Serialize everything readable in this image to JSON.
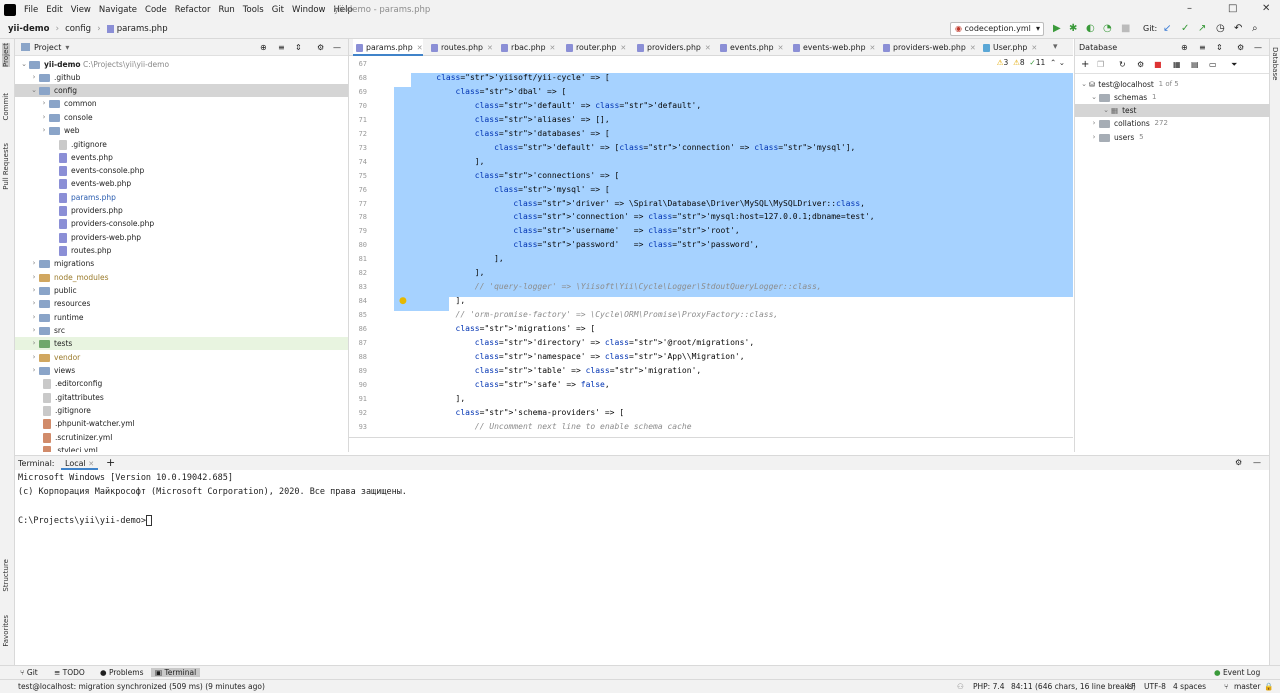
{
  "menu": [
    "File",
    "Edit",
    "View",
    "Navigate",
    "Code",
    "Refactor",
    "Run",
    "Tools",
    "Git",
    "Window",
    "Help"
  ],
  "window_title": "yii-demo - params.php",
  "breadcrumb": [
    "yii-demo",
    "config",
    "params.php"
  ],
  "run_config": "codeception.yml",
  "git_label": "Git:",
  "left_stripe": [
    "Project",
    "Commit",
    "Pull Requests",
    "Structure",
    "Favorites"
  ],
  "right_stripe": [
    "Database"
  ],
  "project": {
    "header": "Project",
    "root": "yii-demo",
    "root_path": "C:\\Projects\\yii\\yii-demo",
    "items": [
      {
        "label": ".github",
        "type": "folder"
      },
      {
        "label": "config",
        "type": "folder"
      },
      {
        "label": "common",
        "type": "folder"
      },
      {
        "label": "console",
        "type": "folder"
      },
      {
        "label": "web",
        "type": "folder"
      },
      {
        "label": ".gitignore",
        "type": "file"
      },
      {
        "label": "events.php",
        "type": "php"
      },
      {
        "label": "events-console.php",
        "type": "php"
      },
      {
        "label": "events-web.php",
        "type": "php"
      },
      {
        "label": "params.php",
        "type": "php"
      },
      {
        "label": "providers.php",
        "type": "php"
      },
      {
        "label": "providers-console.php",
        "type": "php"
      },
      {
        "label": "providers-web.php",
        "type": "php"
      },
      {
        "label": "routes.php",
        "type": "php"
      },
      {
        "label": "migrations",
        "type": "folder"
      },
      {
        "label": "node_modules",
        "type": "folder"
      },
      {
        "label": "public",
        "type": "folder"
      },
      {
        "label": "resources",
        "type": "folder"
      },
      {
        "label": "runtime",
        "type": "folder"
      },
      {
        "label": "src",
        "type": "folder"
      },
      {
        "label": "tests",
        "type": "folder"
      },
      {
        "label": "vendor",
        "type": "folder"
      },
      {
        "label": "views",
        "type": "folder"
      },
      {
        "label": ".editorconfig",
        "type": "file"
      },
      {
        "label": ".gitattributes",
        "type": "file"
      },
      {
        "label": ".gitignore",
        "type": "file"
      },
      {
        "label": ".phpunit-watcher.yml",
        "type": "yml"
      },
      {
        "label": ".scrutinizer.yml",
        "type": "yml"
      },
      {
        "label": ".styleci.yml",
        "type": "yml"
      }
    ]
  },
  "tabs": [
    "params.php",
    "routes.php",
    "rbac.php",
    "router.php",
    "providers.php",
    "events.php",
    "events-web.php",
    "providers-web.php",
    "User.php"
  ],
  "inspections": {
    "warnings": "3",
    "weak": "8",
    "ok": "11"
  },
  "code_lines": [
    {
      "n": "67",
      "t": ""
    },
    {
      "n": "68",
      "t": "    'yiisoft/yii-cycle' => ["
    },
    {
      "n": "69",
      "t": "        'dbal' => ["
    },
    {
      "n": "70",
      "t": "            'default' => 'default',"
    },
    {
      "n": "71",
      "t": "            'aliases' => [],"
    },
    {
      "n": "72",
      "t": "            'databases' => ["
    },
    {
      "n": "73",
      "t": "                'default' => ['connection' => 'mysql'],"
    },
    {
      "n": "74",
      "t": "            ],"
    },
    {
      "n": "75",
      "t": "            'connections' => ["
    },
    {
      "n": "76",
      "t": "                'mysql' => ["
    },
    {
      "n": "77",
      "t": "                    'driver' => \\Spiral\\Database\\Driver\\MySQL\\MySQLDriver::class,"
    },
    {
      "n": "78",
      "t": "                    'connection' => 'mysql:host=127.0.0.1;dbname=test',"
    },
    {
      "n": "79",
      "t": "                    'username'   => 'root',"
    },
    {
      "n": "80",
      "t": "                    'password'   => 'password',"
    },
    {
      "n": "81",
      "t": "                ],"
    },
    {
      "n": "82",
      "t": "            ],"
    },
    {
      "n": "83",
      "t": "            // 'query-logger' => \\Yiisoft\\Yii\\Cycle\\Logger\\StdoutQueryLogger::class,"
    },
    {
      "n": "84",
      "t": "        ],"
    },
    {
      "n": "85",
      "t": "        // 'orm-promise-factory' => \\Cycle\\ORM\\Promise\\ProxyFactory::class,"
    },
    {
      "n": "86",
      "t": "        'migrations' => ["
    },
    {
      "n": "87",
      "t": "            'directory' => '@root/migrations',"
    },
    {
      "n": "88",
      "t": "            'namespace' => 'App\\\\Migration',"
    },
    {
      "n": "89",
      "t": "            'table' => 'migration',"
    },
    {
      "n": "90",
      "t": "            'safe' => false,"
    },
    {
      "n": "91",
      "t": "        ],"
    },
    {
      "n": "92",
      "t": "        'schema-providers' => ["
    },
    {
      "n": "93",
      "t": "            // Uncomment next line to enable schema cache"
    }
  ],
  "database": {
    "header": "Database",
    "connection": "test@localhost",
    "connection_count": "1 of 5",
    "schemas_label": "schemas",
    "schemas_count": "1",
    "schema_test": "test",
    "collations_label": "collations",
    "collations_count": "272",
    "users_label": "users",
    "users_count": "5"
  },
  "terminal": {
    "title": "Terminal:",
    "tab": "Local",
    "lines": [
      "Microsoft Windows [Version 10.0.19042.685]",
      "(c) Корпорация Майкрософт (Microsoft Corporation), 2020. Все права защищены.",
      "",
      "C:\\Projects\\yii\\yii-demo>"
    ]
  },
  "bottom_tools": [
    "Git",
    "TODO",
    "Problems",
    "Terminal"
  ],
  "event_log": "Event Log",
  "status": {
    "message": "test@localhost: migration synchronized (509 ms) (9 minutes ago)",
    "php": "PHP: 7.4",
    "position": "84:11 (646 chars, 16 line breaks)",
    "line_sep": "LF",
    "encoding": "UTF-8",
    "indent": "4 spaces",
    "branch": "master"
  }
}
